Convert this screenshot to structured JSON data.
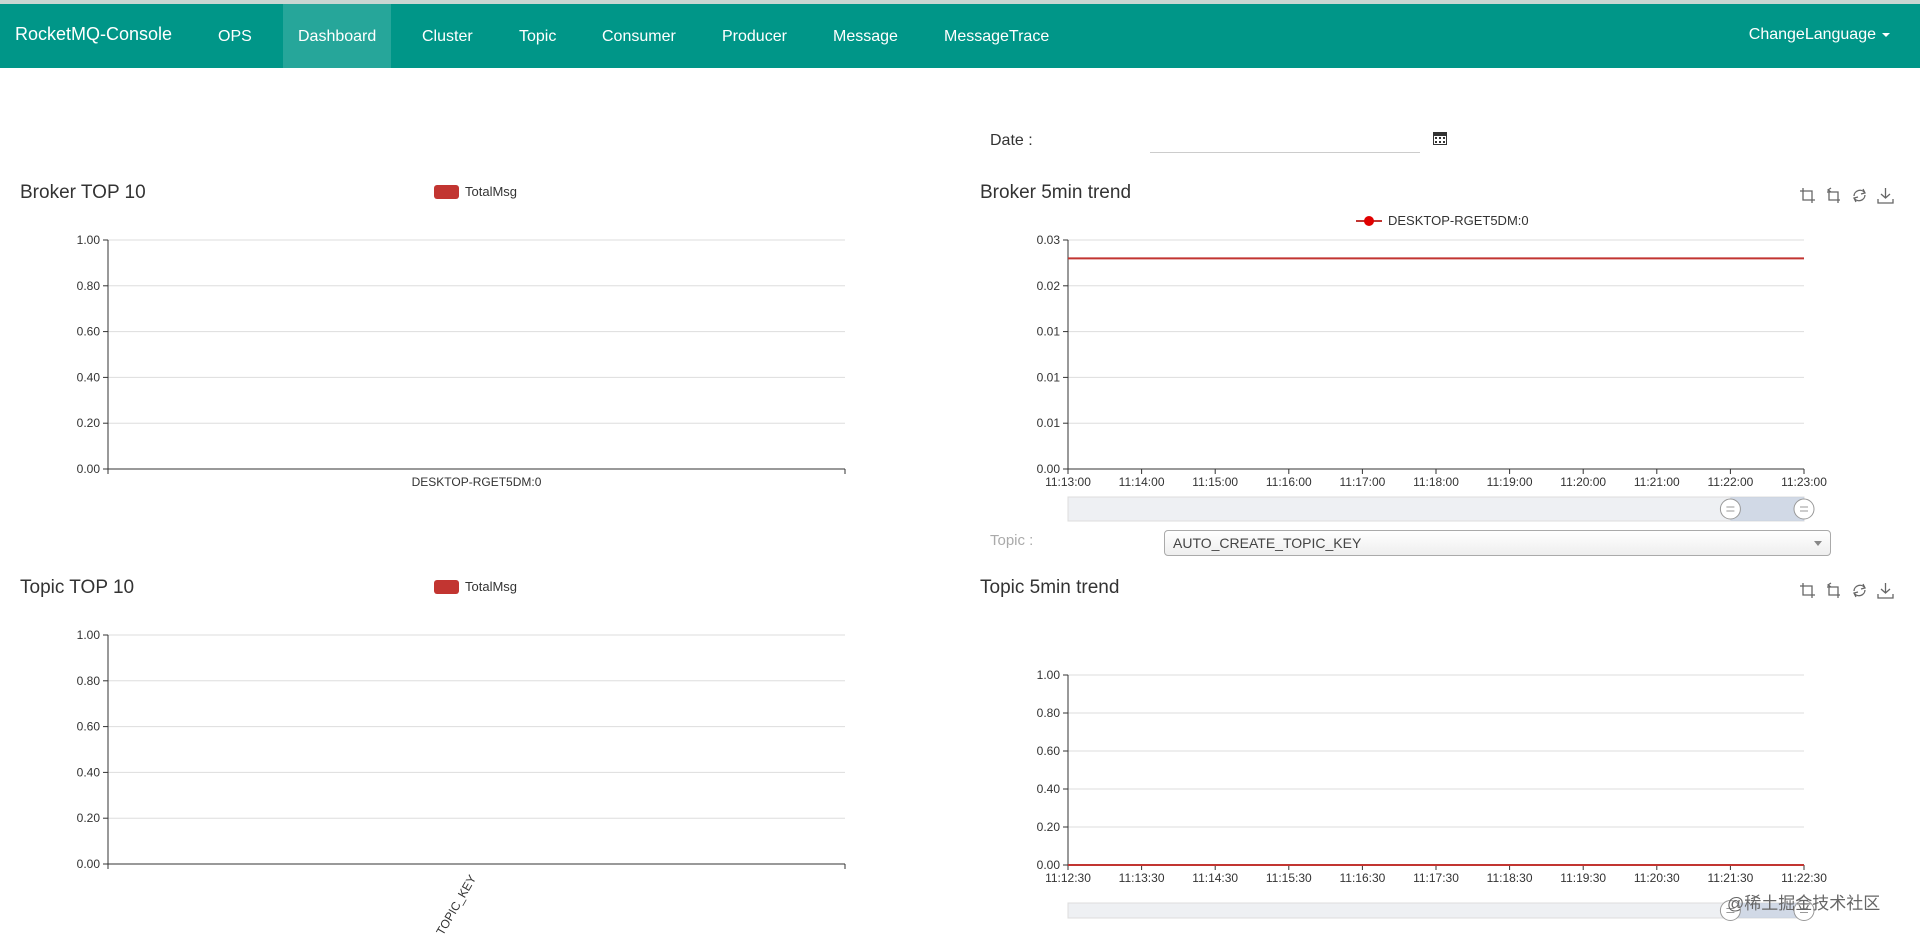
{
  "navbar": {
    "brand": "RocketMQ-Console",
    "items": [
      {
        "label": "OPS"
      },
      {
        "label": "Dashboard",
        "active": true
      },
      {
        "label": "Cluster"
      },
      {
        "label": "Topic"
      },
      {
        "label": "Consumer"
      },
      {
        "label": "Producer"
      },
      {
        "label": "Message"
      },
      {
        "label": "MessageTrace"
      }
    ],
    "language": "ChangeLanguage"
  },
  "date_filter": {
    "label": "Date :",
    "value": ""
  },
  "topic_filter": {
    "label": "Topic :",
    "selected": "AUTO_CREATE_TOPIC_KEY"
  },
  "colors": {
    "primary": "#009688",
    "active": "#26a69a",
    "series": "#c23531"
  },
  "panels": {
    "broker_top": {
      "title": "Broker TOP 10",
      "legend": "TotalMsg"
    },
    "broker_trend": {
      "title": "Broker 5min trend",
      "legend": "DESKTOP-RGET5DM:0"
    },
    "topic_top": {
      "title": "Topic TOP 10",
      "legend": "TotalMsg"
    },
    "topic_trend": {
      "title": "Topic 5min trend"
    }
  },
  "toolbox_icons": [
    "zoom-icon",
    "zoom-reset-icon",
    "restore-icon",
    "download-icon"
  ],
  "watermark": "@稀土掘金技术社区",
  "chart_data": [
    {
      "id": "broker_top",
      "type": "bar",
      "title": "Broker TOP 10",
      "categories": [
        "DESKTOP-RGET5DM:0"
      ],
      "series": [
        {
          "name": "TotalMsg",
          "values": [
            0
          ]
        }
      ],
      "yticks": [
        "0.00",
        "0.20",
        "0.40",
        "0.60",
        "0.80",
        "1.00"
      ],
      "ylim": [
        0,
        1
      ],
      "grid": true,
      "legend": "top-center"
    },
    {
      "id": "broker_trend",
      "type": "line",
      "title": "Broker 5min trend",
      "x": [
        "11:13:00",
        "11:14:00",
        "11:15:00",
        "11:16:00",
        "11:17:00",
        "11:18:00",
        "11:19:00",
        "11:20:00",
        "11:21:00",
        "11:22:00",
        "11:23:00"
      ],
      "series": [
        {
          "name": "DESKTOP-RGET5DM:0",
          "values": [
            0.023,
            0.023,
            0.023,
            0.023,
            0.023,
            0.023,
            0.023,
            0.023,
            0.023,
            0.023,
            0.023
          ]
        }
      ],
      "yticks": [
        "0.00",
        "0.01",
        "0.01",
        "0.01",
        "0.02",
        "0.03"
      ],
      "ylim": [
        0,
        0.025
      ],
      "grid": true,
      "legend": "top-center",
      "datazoom": true
    },
    {
      "id": "topic_top",
      "type": "bar",
      "title": "Topic TOP 10",
      "categories": [
        "TOPIC_KEY"
      ],
      "series": [
        {
          "name": "TotalMsg",
          "values": [
            0
          ]
        }
      ],
      "yticks": [
        "0.00",
        "0.20",
        "0.40",
        "0.60",
        "0.80",
        "1.00"
      ],
      "ylim": [
        0,
        1
      ],
      "grid": true,
      "legend": "top-center"
    },
    {
      "id": "topic_trend",
      "type": "line",
      "title": "Topic 5min trend",
      "x": [
        "11:12:30",
        "11:13:30",
        "11:14:30",
        "11:15:30",
        "11:16:30",
        "11:17:30",
        "11:18:30",
        "11:19:30",
        "11:20:30",
        "11:21:30",
        "11:22:30"
      ],
      "series": [
        {
          "values": [
            0,
            0,
            0,
            0,
            0,
            0,
            0,
            0,
            0,
            0,
            0
          ]
        }
      ],
      "yticks": [
        "0.00",
        "0.20",
        "0.40",
        "0.60",
        "0.80",
        "1.00"
      ],
      "ylim": [
        0,
        1
      ],
      "grid": true,
      "datazoom": true
    }
  ]
}
